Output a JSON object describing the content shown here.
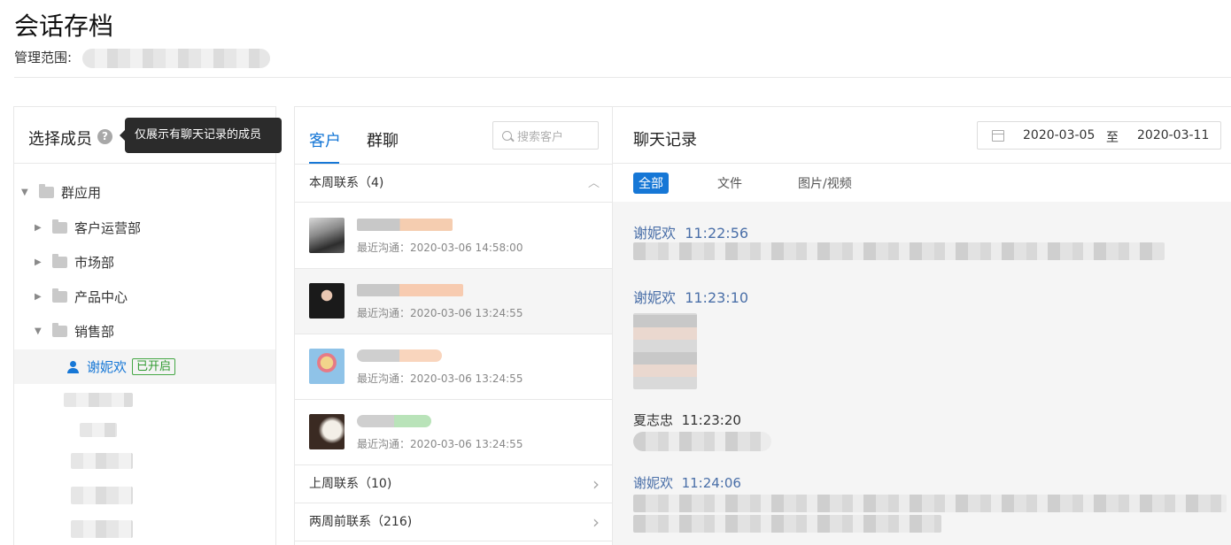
{
  "header": {
    "title": "会话存档",
    "scope_label": "管理范围:"
  },
  "left": {
    "title": "选择成员",
    "help_glyph": "?",
    "tooltip": "仅展示有聊天记录的成员",
    "tree": {
      "root": "群应用",
      "children": [
        "客户运营部",
        "市场部",
        "产品中心",
        "销售部"
      ]
    },
    "active_member": {
      "name": "谢妮欢",
      "badge": "已开启"
    }
  },
  "middle": {
    "tabs": [
      "客户",
      "群聊"
    ],
    "search_placeholder": "搜索客户",
    "groups": [
      {
        "label": "本周联系（4)",
        "expanded": true
      },
      {
        "label": "上周联系（10)",
        "expanded": false
      },
      {
        "label": "两周前联系（216)",
        "expanded": false
      }
    ],
    "contacts": [
      {
        "last": "最近沟通：2020-03-06  14:58:00"
      },
      {
        "last": "最近沟通：2020-03-06  13:24:55"
      },
      {
        "last": "最近沟通：2020-03-06  13:24:55"
      },
      {
        "last": "最近沟通：2020-03-06  13:24:55"
      }
    ],
    "chevron_up": "︿",
    "chevron_right": "›"
  },
  "right": {
    "title": "聊天记录",
    "date_start": "2020-03-05",
    "date_sep": "至",
    "date_end": "2020-03-11",
    "filters": [
      "全部",
      "文件",
      "图片/视频"
    ],
    "messages": [
      {
        "sender": "谢妮欢",
        "time": "11:22:56"
      },
      {
        "sender": "谢妮欢",
        "time": "11:23:10"
      },
      {
        "sender": "夏志忠",
        "time": "11:23:20"
      },
      {
        "sender": "谢妮欢",
        "time": "11:24:06"
      }
    ]
  },
  "colors": {
    "accent": "#1677d6",
    "badge_green": "#2f9a2f",
    "sender_blue": "#4a6fa8"
  }
}
